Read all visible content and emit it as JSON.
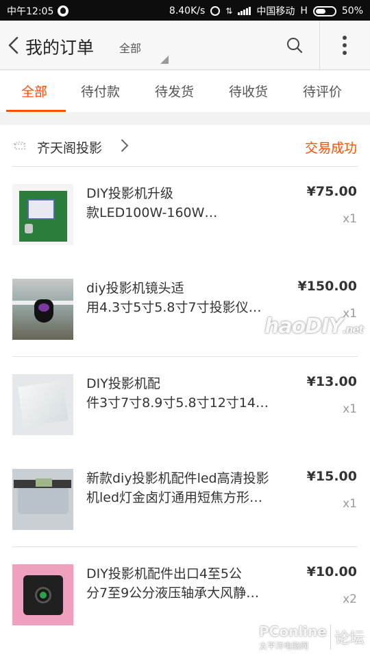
{
  "statusbar": {
    "time": "中午12:05",
    "speed": "8.40K/s",
    "carrier": "中国移动",
    "network_type": "H",
    "battery": "50%"
  },
  "navbar": {
    "title": "我的订单",
    "filter_label": "全部"
  },
  "tabs": [
    {
      "label": "全部",
      "active": true
    },
    {
      "label": "待付款",
      "active": false
    },
    {
      "label": "待发货",
      "active": false
    },
    {
      "label": "待收货",
      "active": false
    },
    {
      "label": "待评价",
      "active": false
    }
  ],
  "order": {
    "shop_name": "齐天阁投影",
    "status": "交易成功",
    "items": [
      {
        "line1": "DIY投影机升级",
        "line2": "款LED100W-160W…",
        "price": "¥75.00",
        "qty": "x1",
        "thumb_icon": "power-board-icon"
      },
      {
        "line1": "diy投影机镜头适",
        "line2": "用4.3寸5寸5.8寸7寸投影仪…",
        "price": "¥150.00",
        "qty": "x1",
        "thumb_icon": "lens-icon"
      },
      {
        "line1": "DIY投影机配",
        "line2": "件3寸7寸8.9寸5.8寸12寸14…",
        "price": "¥13.00",
        "qty": "x1",
        "thumb_icon": "fresnel-sheet-icon"
      },
      {
        "line1": "新款diy投影机配件led高清投影",
        "line2": "机led灯金卤灯通用短焦方形…",
        "price": "¥15.00",
        "qty": "x1",
        "thumb_icon": "lens-caliper-icon"
      },
      {
        "line1": "DIY投影机配件出口4至5公",
        "line2": "分7至9公分液压轴承大风静…",
        "price": "¥10.00",
        "qty": "x2",
        "thumb_icon": "cooling-fan-icon"
      }
    ]
  },
  "watermarks": {
    "haodiy": "haoDIY",
    "haodiy_suffix": ".net",
    "pconline": "PConline",
    "pconline_sub": "太平洋电脑网",
    "forum": "论坛"
  },
  "colors": {
    "accent": "#ff5000",
    "text": "#333333",
    "muted": "#999999"
  }
}
